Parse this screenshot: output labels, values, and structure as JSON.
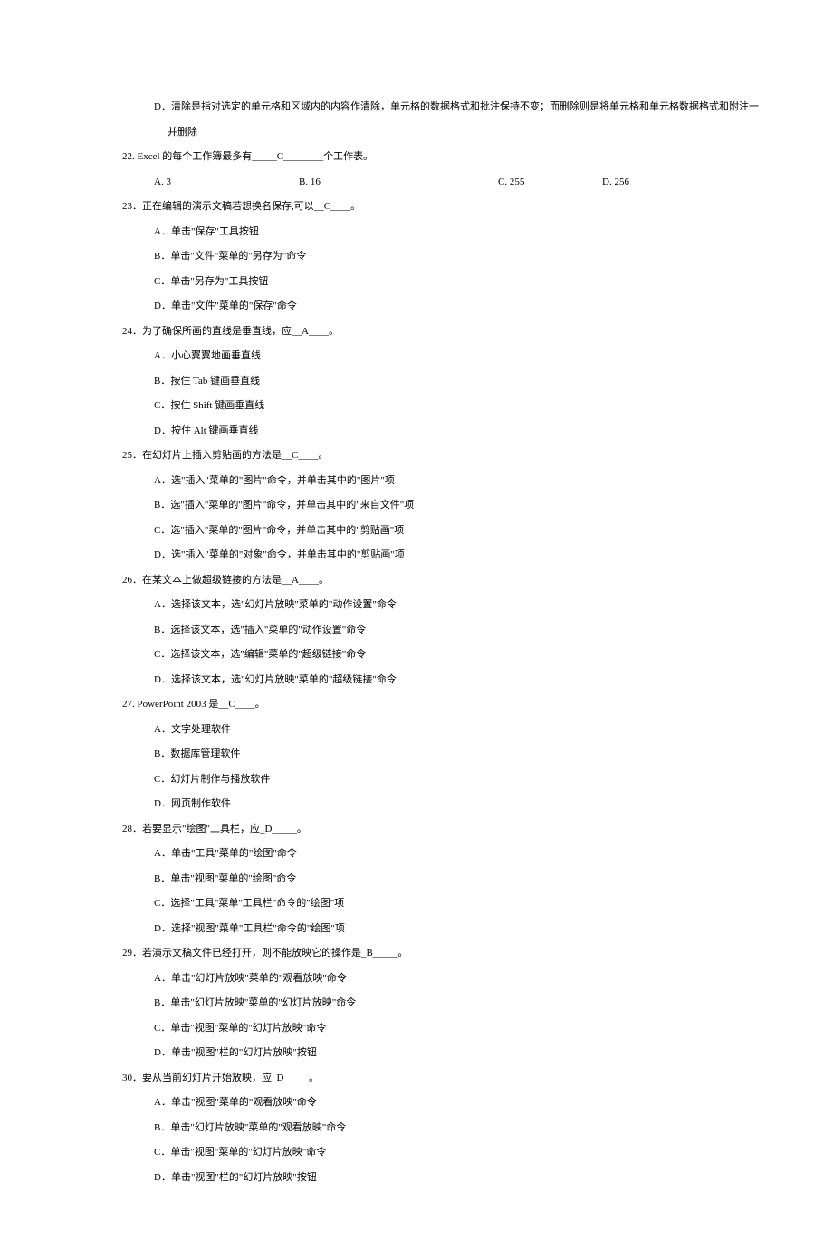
{
  "q21d_1": "D．清除是指对选定的单元格和区域内的内容作清除，单元格的数据格式和批注保持不变；而删除则是将单元格和单元格数据格式和附注一",
  "q21d_2": "并删除",
  "q22": "22. Excel 的每个工作簿最多有_____C________个工作表。",
  "q22a": "A. 3",
  "q22b": "B. 16",
  "q22c": "C. 255",
  "q22d": "D. 256",
  "q23": "23．正在编辑的演示文稿若想换名保存,可以__C____。",
  "q23a": "A．单击\"保存\"工具按钮",
  "q23b": "B．单击\"文件\"菜单的\"另存为\"命令",
  "q23c": "C．单击\"另存为\"工具按钮",
  "q23d": "D．单击\"文件\"菜单的\"保存\"命令",
  "q24": "24．为了确保所画的直线是垂直线，应__A____。",
  "q24a": "A．小心翼翼地画垂直线",
  "q24b": "B．按住 Tab 键画垂直线",
  "q24c": "C．按住 Shift 键画垂直线",
  "q24d": "D．按住 Alt 键画垂直线",
  "q25": "25．在幻灯片上插入剪贴画的方法是__C____。",
  "q25a": "A．选\"插入\"菜单的\"图片\"命令，并单击其中的\"图片\"项",
  "q25b": "B．选\"插入\"菜单的\"图片\"命令，并单击其中的\"来自文件\"项",
  "q25c": "C．选\"插入\"菜单的\"图片\"命令，并单击其中的\"剪贴画\"项",
  "q25d": "D．选\"插入\"菜单的\"对象\"命令，并单击其中的\"剪贴画\"项",
  "q26": "26．在某文本上做超级链接的方法是__A____。",
  "q26a": "A．选择该文本，选\"幻灯片放映\"菜单的\"动作设置\"命令",
  "q26b": "B．选择该文本，选\"插入\"菜单的\"动作设置\"命令",
  "q26c": "C．选择该文本，选\"编辑\"菜单的\"超级链接\"命令",
  "q26d": "D．选择该文本，选\"幻灯片放映\"菜单的\"超级链接\"命令",
  "q27": "27. PowerPoint 2003 是__C____。",
  "q27a": "A．文字处理软件",
  "q27b": "B．数据库管理软件",
  "q27c": "C．幻灯片制作与播放软件",
  "q27d": "D．网页制作软件",
  "q28": "28．若要显示\"绘图\"工具栏，应_D_____。",
  "q28a": "A．单击\"工具\"菜单的\"绘图\"命令",
  "q28b": "B．单击\"视图\"菜单的\"绘图\"命令",
  "q28c": "C．选择\"工具\"菜单\"工具栏\"命令的\"绘图\"项",
  "q28d": "D．选择\"视图\"菜单\"工具栏\"命令的\"绘图\"项",
  "q29": "29．若演示文稿文件已经打开，则不能放映它的操作是_B_____。",
  "q29a": "A．单击\"幻灯片放映\"菜单的\"观看放映\"命令",
  "q29b": "B．单击\"幻灯片放映\"菜单的\"幻灯片放映\"命令",
  "q29c": "C．单击\"视图\"菜单的\"幻灯片放映\"命令",
  "q29d": "D．单击\"视图\"栏的\"幻灯片放映\"按钮",
  "q30": "30．要从当前幻灯片开始放映，应_D_____。",
  "q30a": "A．单击\"视图\"菜单的\"观看放映\"命令",
  "q30b": "B．单击\"幻灯片放映\"菜单的\"观看放映\"命令",
  "q30c": "C．单击\"视图\"菜单的\"幻灯片放映\"命令",
  "q30d": "D．单击\"视图\"栏的\"幻灯片放映\"按钮"
}
